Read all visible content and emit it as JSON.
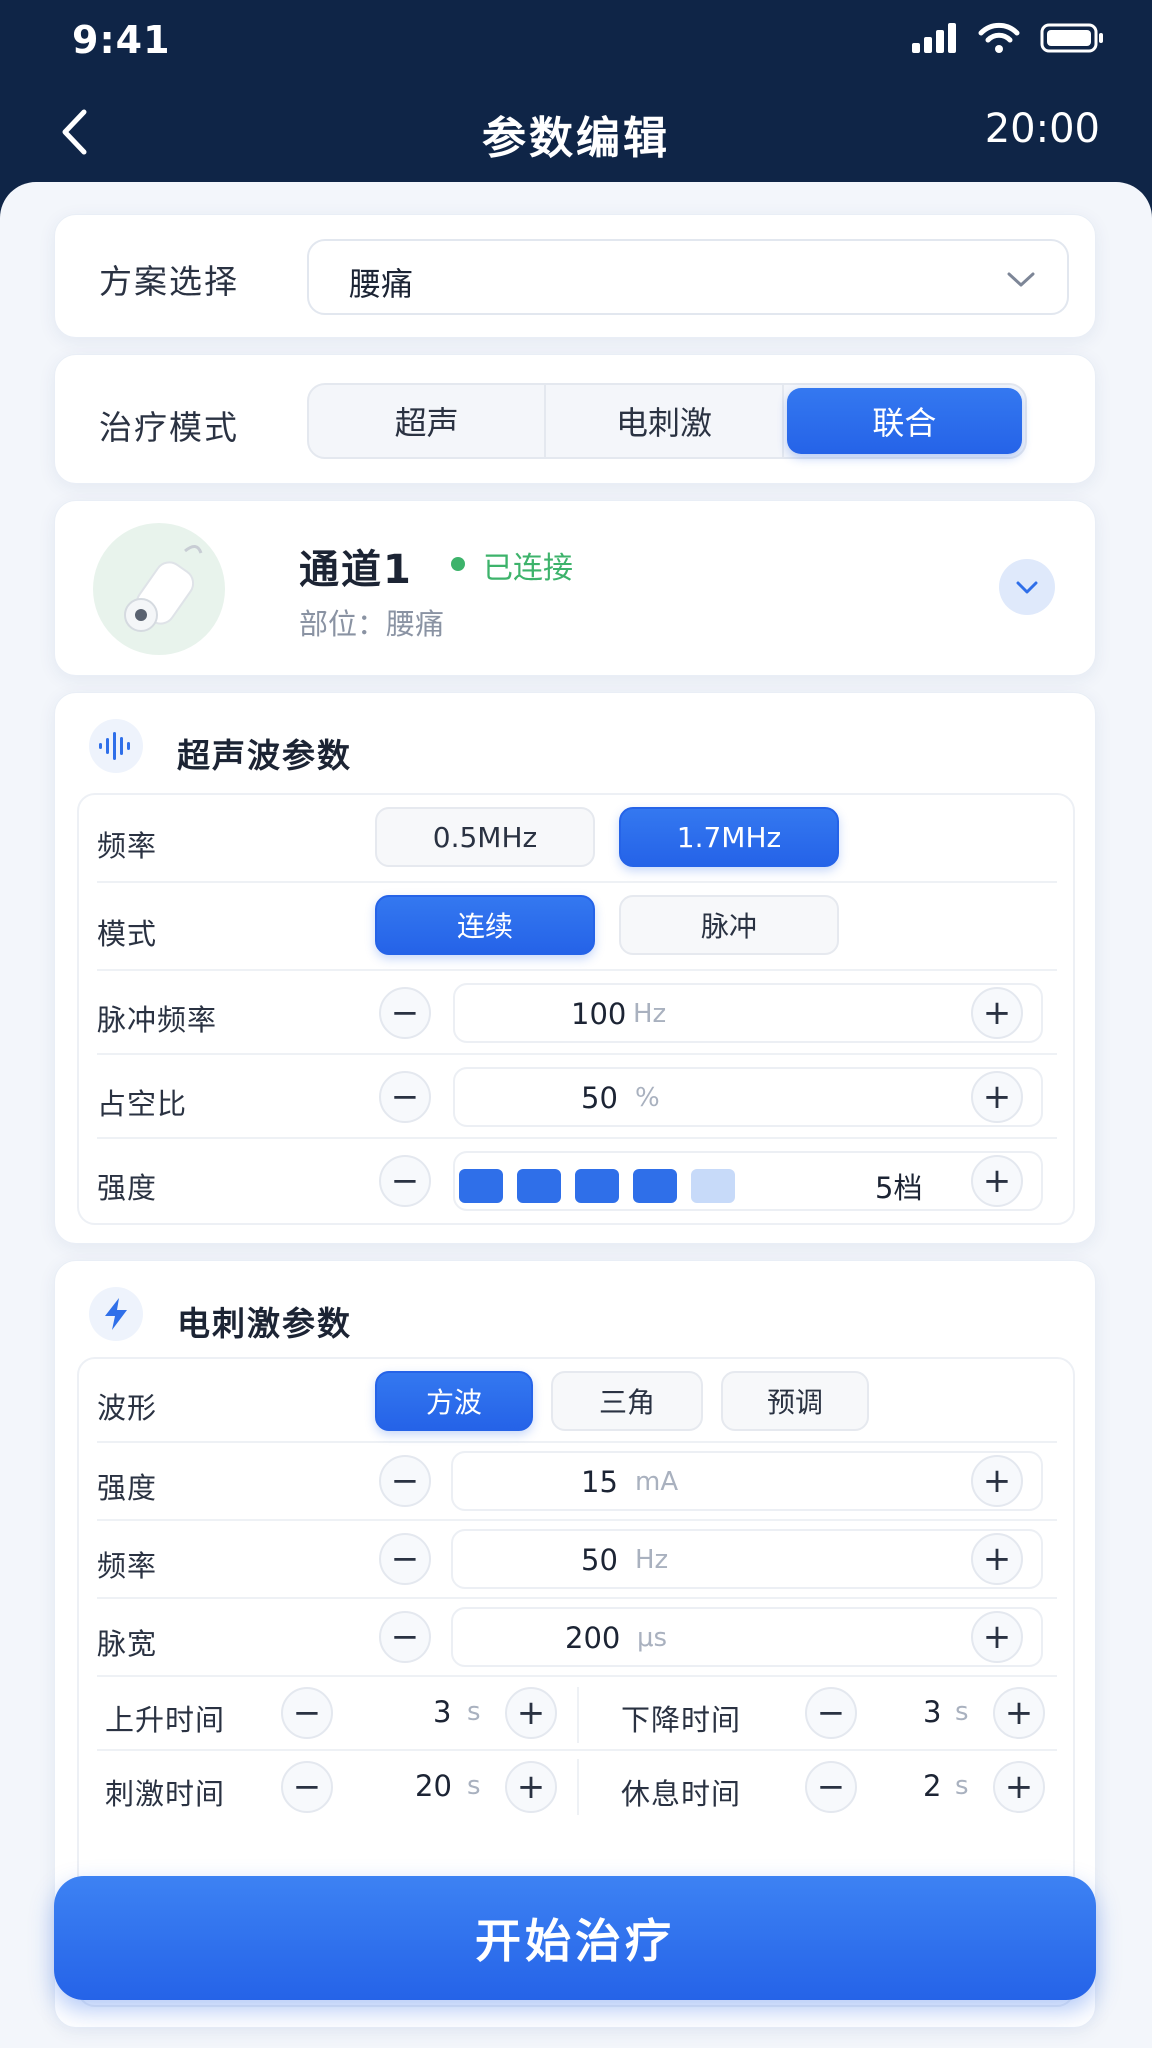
{
  "status_bar": {
    "time": "9:41"
  },
  "nav": {
    "title": "参数编辑",
    "timer": "20:00"
  },
  "scheme": {
    "label": "方案选择",
    "value": "腰痛"
  },
  "mode": {
    "label": "治疗模式",
    "options": [
      "超声",
      "电刺激",
      "联合"
    ],
    "selected": "联合"
  },
  "channel": {
    "name": "通道1",
    "status": "已连接",
    "location": "部位：腰痛"
  },
  "ultrasound": {
    "title": "超声波参数",
    "frequency": {
      "label": "频率",
      "options": [
        "0.5MHz",
        "1.7MHz"
      ],
      "selected": "1.7MHz"
    },
    "mode": {
      "label": "模式",
      "options": [
        "连续",
        "脉冲"
      ],
      "selected": "连续"
    },
    "pulse_freq": {
      "label": "脉冲频率",
      "value": "100",
      "unit": "Hz"
    },
    "duty": {
      "label": "占空比",
      "value": "50",
      "unit": "%"
    },
    "intensity": {
      "label": "强度",
      "level_text": "5档",
      "filled_blocks": 4,
      "total_blocks": 5
    }
  },
  "electro": {
    "title": "电刺激参数",
    "waveform": {
      "label": "波形",
      "options": [
        "方波",
        "三角",
        "预调"
      ],
      "selected": "方波"
    },
    "intensity": {
      "label": "强度",
      "value": "15",
      "unit": "mA"
    },
    "frequency": {
      "label": "频率",
      "value": "50",
      "unit": "Hz"
    },
    "pulse_width": {
      "label": "脉宽",
      "value": "200",
      "unit": "μs"
    },
    "rise_time": {
      "label": "上升时间",
      "value": "3",
      "unit": "s"
    },
    "fall_time": {
      "label": "下降时间",
      "value": "3",
      "unit": "s"
    },
    "stim_time": {
      "label": "刺激时间",
      "value": "20",
      "unit": "s"
    },
    "rest_time": {
      "label": "休息时间",
      "value": "2",
      "unit": "s"
    }
  },
  "start_button": {
    "label": "开始治疗"
  },
  "colors": {
    "primary": "#2563e8",
    "header": "#0f2547",
    "success": "#3db36b"
  }
}
